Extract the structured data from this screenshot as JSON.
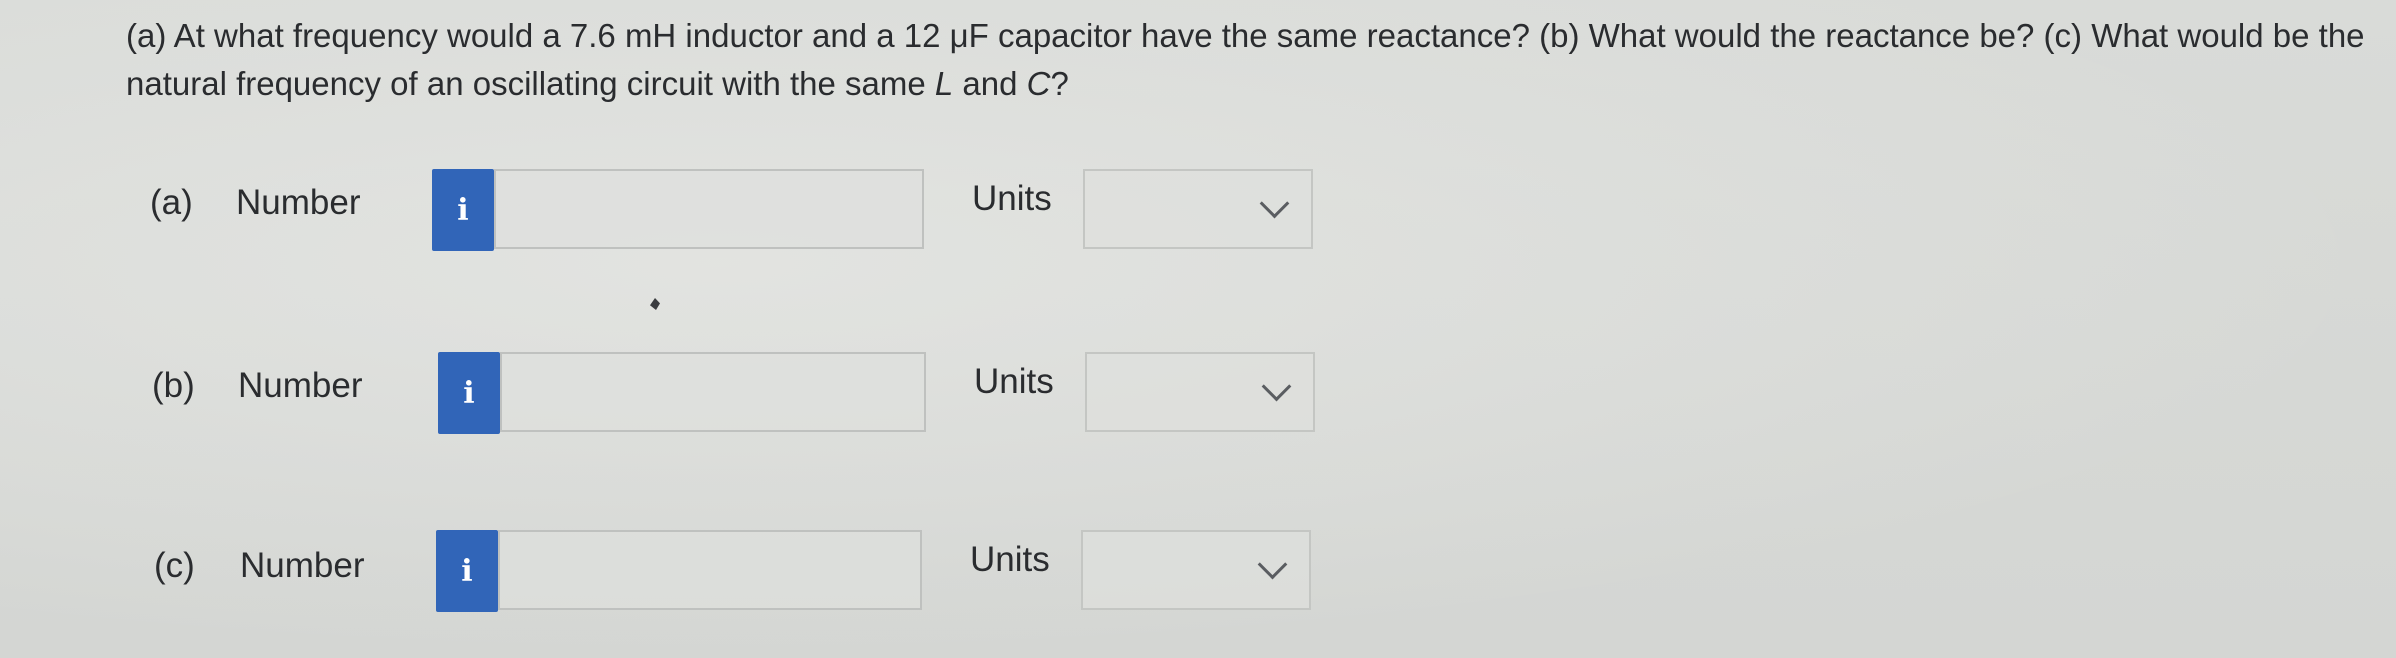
{
  "question": {
    "part_a_prefix": "(a) At what frequency would a 7.6 mH inductor and a 12 μF capacitor have the same reactance? (b) What would the reactance be? (c) What would be the natural frequency of an oscillating circuit with the same ",
    "var_L": "L",
    "and_text": " and ",
    "var_C": "C",
    "suffix": "?"
  },
  "answers": [
    {
      "part": "(a)",
      "number_label": "Number",
      "info_icon": "i",
      "number_value": "",
      "units_label": "Units",
      "units_value": ""
    },
    {
      "part": "(b)",
      "number_label": "Number",
      "info_icon": "i",
      "number_value": "",
      "units_label": "Units",
      "units_value": ""
    },
    {
      "part": "(c)",
      "number_label": "Number",
      "info_icon": "i",
      "number_value": "",
      "units_label": "Units",
      "units_value": ""
    }
  ],
  "icons": {
    "info": "info-icon",
    "dropdown": "chevron-down-icon"
  },
  "colors": {
    "info_button": "#3165b8",
    "background": "#d7d9d6"
  }
}
